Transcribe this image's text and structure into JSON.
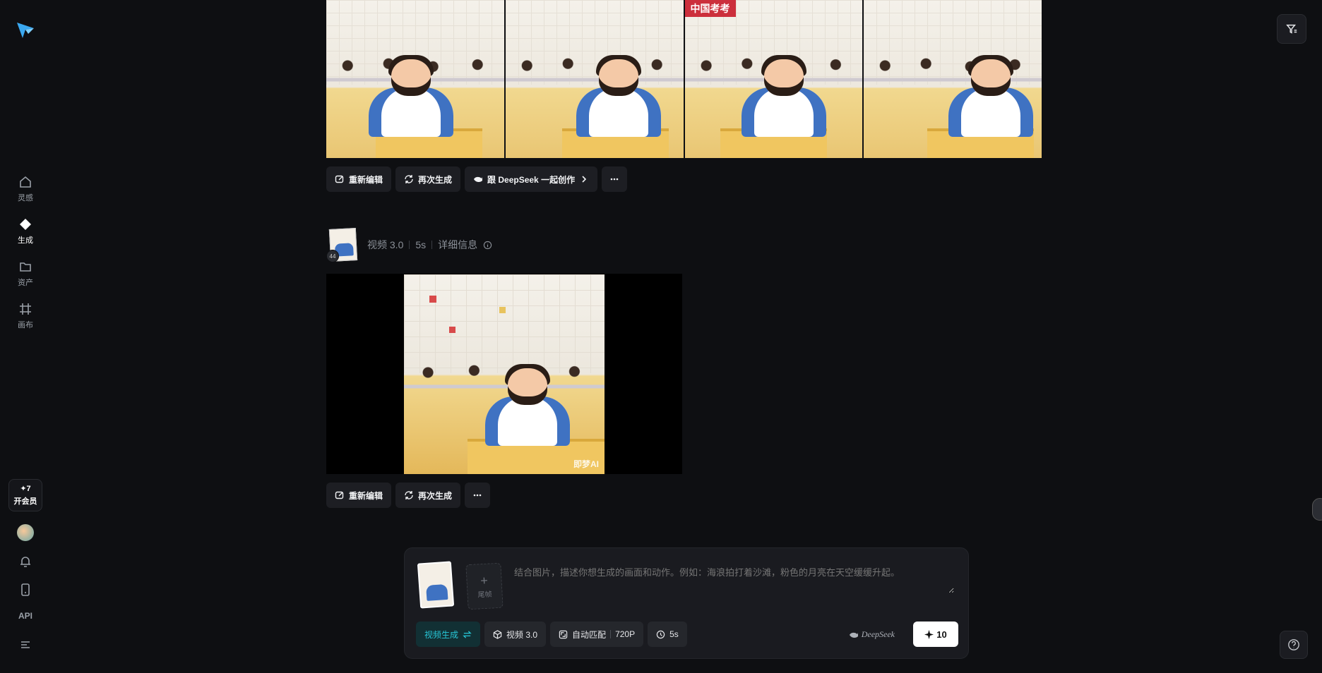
{
  "sidebar": {
    "items": [
      {
        "label": "灵感",
        "icon": "home-icon"
      },
      {
        "label": "生成",
        "icon": "sparkle-icon"
      },
      {
        "label": "资产",
        "icon": "folder-icon"
      },
      {
        "label": "画布",
        "icon": "canvas-icon"
      }
    ],
    "vip": {
      "credits": "✦7",
      "label": "开会员"
    },
    "api_label": "API"
  },
  "gallery": {
    "banner_text": "中国考考",
    "actions": {
      "reedit": "重新编辑",
      "regenerate": "再次生成",
      "deepseek": "跟 DeepSeek 一起创作"
    }
  },
  "video_card": {
    "model": "视频 3.0",
    "duration": "5s",
    "details": "详细信息",
    "badge": "44",
    "watermark": "即梦AI",
    "actions": {
      "reedit": "重新编辑",
      "regenerate": "再次生成"
    }
  },
  "composer": {
    "tail_label": "尾帧",
    "placeholder": "结合图片，描述你想生成的画面和动作。例如：海浪拍打着沙滩，粉色的月亮在天空缓缓升起。",
    "mode": "视频生成",
    "model": "视频 3.0",
    "ratio": "自动匹配",
    "resolution": "720P",
    "duration": "5s",
    "deepseek_label": "DeepSeek",
    "send_cost": "10"
  },
  "colors": {
    "background": "#0e0f12",
    "accent_cyan": "#27c6d6",
    "uniform_blue": "#3f72c2"
  }
}
